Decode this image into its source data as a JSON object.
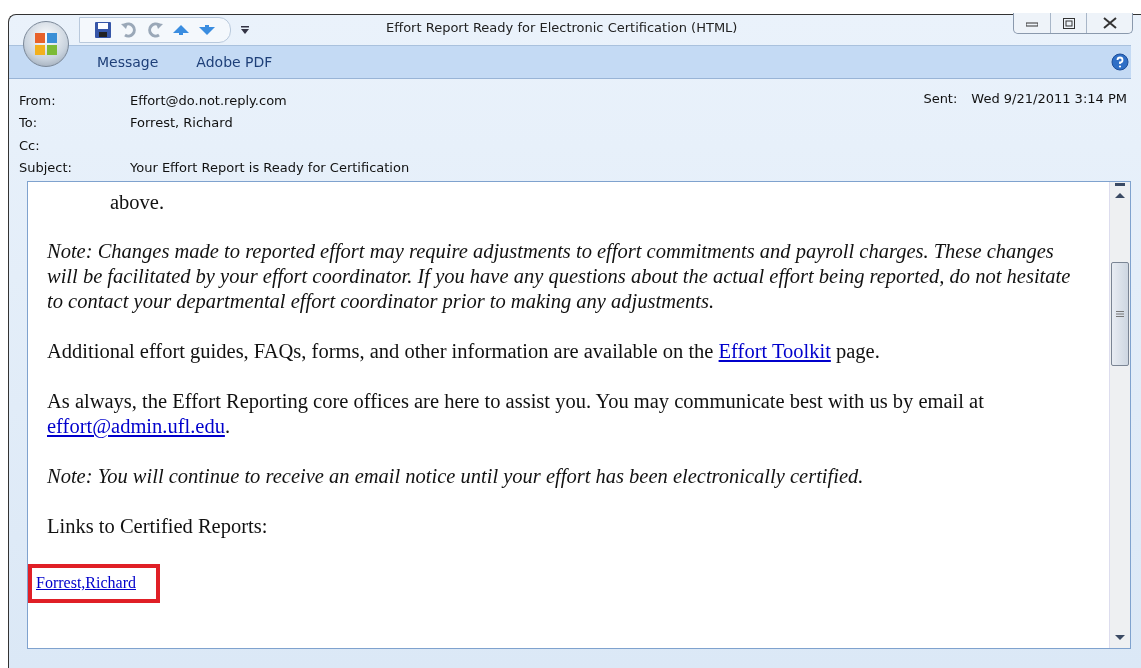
{
  "window": {
    "title": "Effort Report Ready for Electronic Certification  (HTML)"
  },
  "ribbon_tabs": [
    {
      "label": "Message"
    },
    {
      "label": "Adobe PDF"
    }
  ],
  "header": {
    "fields": [
      {
        "label": "From:",
        "value": "Effort@do.not.reply.com"
      },
      {
        "label": "To:",
        "value": "Forrest, Richard"
      },
      {
        "label": "Cc:"
      },
      {
        "label": "Subject:",
        "value": "Your Effort Report is Ready for Certification"
      }
    ],
    "sent": {
      "label": "Sent:",
      "value": "Wed 9/21/2011 3:14 PM"
    }
  },
  "body": [
    {
      "kind": "indented",
      "parts": [
        {
          "text": "above."
        }
      ]
    },
    {
      "kind": "note",
      "parts": [
        {
          "text": "Note: Changes made to reported effort may require adjustments to effort commitments and payroll charges. These changes will be facilitated by your effort coordinator. If you have any questions about the actual effort being reported, do not hesitate to contact your departmental effort coordinator prior to making any adjustments."
        }
      ]
    },
    {
      "kind": "plain",
      "parts": [
        {
          "text": "Additional effort guides, FAQs, forms, and other information are available on the "
        },
        {
          "link": "Effort Toolkit"
        },
        {
          "text": " page."
        }
      ]
    },
    {
      "kind": "plain",
      "parts": [
        {
          "text": "As always, the Effort Reporting core offices are here to assist you. You may communicate best with us by email at "
        },
        {
          "link": "effort@admin.ufl.edu"
        },
        {
          "text": "."
        }
      ]
    },
    {
      "kind": "note",
      "parts": [
        {
          "text": "Note: You will continue to receive an email notice until your effort has been electronically certified."
        }
      ]
    },
    {
      "kind": "plain",
      "parts": [
        {
          "text": "Links to Certified Reports:"
        }
      ]
    },
    {
      "kind": "highlighted-link",
      "parts": [
        {
          "link": "Forrest,Richard"
        }
      ]
    }
  ]
}
